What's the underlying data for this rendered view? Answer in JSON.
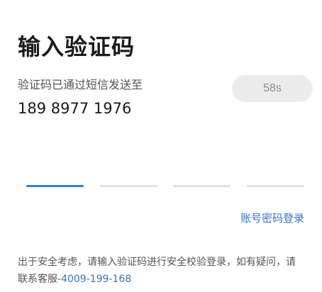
{
  "header": {
    "title": "输入验证码"
  },
  "sms": {
    "sent_hint": "验证码已通过短信发送至",
    "phone_number": "189 8977 1976",
    "countdown_label": "58s"
  },
  "code_input": {
    "slot_count": 4,
    "active_index": 0
  },
  "links": {
    "password_login": "账号密码登录"
  },
  "notice": {
    "text": "出于安全考虑，请输入验证码进行安全校验登录，如有疑问，请联系客服-",
    "support_phone": "4009-199-168"
  },
  "colors": {
    "accent": "#3a7bd5",
    "link": "#3a73c9",
    "inactive_slot": "#e0e0e0",
    "button_bg": "#ececec"
  }
}
